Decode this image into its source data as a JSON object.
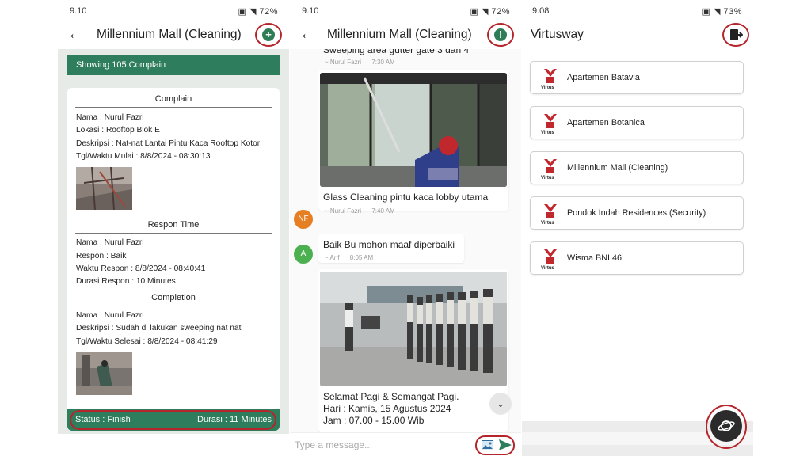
{
  "screen1": {
    "status": {
      "time": "9.10",
      "right": "72%"
    },
    "title": "Millennium Mall (Cleaning)",
    "back_icon": "arrow-left-icon",
    "add_icon": "plus-circle-icon",
    "banner": "Showing 105 Complain",
    "complain": {
      "heading": "Complain",
      "nama": "Nama : Nurul Fazri",
      "lokasi": "Lokasi : Rooftop Blok E",
      "deskripsi": "Deskripsi : Nat-nat Lantai Pintu Kaca Rooftop Kotor",
      "waktu": "Tgl/Waktu Mulai : 8/8/2024 - 08:30:13"
    },
    "respon": {
      "heading": "Respon Time",
      "nama": "Nama : Nurul Fazri",
      "respon": "Respon : Baik",
      "waktu": "Waktu Respon : 8/8/2024 - 08:40:41",
      "durasi": "Durasi Respon : 10 Minutes"
    },
    "completion": {
      "heading": "Completion",
      "nama": "Nama : Nurul Fazri",
      "deskripsi": "Deskripsi : Sudah di lakukan sweeping nat nat",
      "waktu": "Tgl/Waktu Selesai : 8/8/2024 - 08:41:29"
    },
    "footer": {
      "status": "Status : Finish",
      "durasi": "Durasi : 11  Minutes"
    },
    "colors": {
      "accent": "#2e7d5c",
      "highlight": "#b5252b"
    }
  },
  "screen2": {
    "status": {
      "time": "9.10",
      "right": "72%"
    },
    "title": "Millennium Mall (Cleaning)",
    "alert_icon": "exclamation-circle-icon",
    "messages": [
      {
        "text": "Sweeping area gutter gate 3 dan 4",
        "sender": "~ Nurul Fazri",
        "time": "7:30 AM"
      },
      {
        "text": "Glass Cleaning pintu kaca lobby utama",
        "sender": "~ Nurul Fazri",
        "time": "7:40 AM",
        "avatar": "NF"
      },
      {
        "text": "Baik Bu mohon maaf diperbaiki",
        "sender": "~ Arif",
        "time": "8:05 AM",
        "avatar": "A"
      },
      {
        "lines": [
          "Selamat Pagi & Semangat Pagi.",
          "Hari : Kamis, 15 Agustus 2024",
          "Jam : 07.00 - 15.00 Wib"
        ]
      }
    ],
    "composer_placeholder": "Type a message...",
    "icons": {
      "attach": "image-icon",
      "send": "send-icon",
      "scroll": "chevron-down-icon"
    }
  },
  "screen3": {
    "status": {
      "time": "9.08",
      "right": "73%"
    },
    "title": "Virtusway",
    "logout_icon": "logout-icon",
    "logo_text": "Virtus",
    "sites": [
      "Apartemen Batavia",
      "Apartemen Botanica",
      "Millennium Mall (Cleaning)",
      "Pondok Indah Residences (Security)",
      "Wisma BNI 46"
    ],
    "fab_icon": "planet-icon"
  }
}
